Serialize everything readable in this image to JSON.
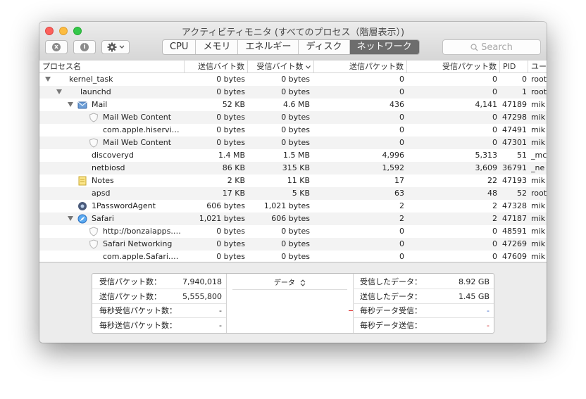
{
  "window": {
    "title": "アクティビティモニタ (すべてのプロセス（階層表示）)"
  },
  "toolbar": {
    "stop_icon": "x",
    "info_icon": "i",
    "tabs": [
      {
        "label": "CPU",
        "active": false
      },
      {
        "label": "メモリ",
        "active": false
      },
      {
        "label": "エネルギー",
        "active": false
      },
      {
        "label": "ディスク",
        "active": false
      },
      {
        "label": "ネットワーク",
        "active": true
      }
    ],
    "search_placeholder": "Search"
  },
  "columns": {
    "name": "プロセス名",
    "sent_bytes": "送信バイト数",
    "recv_bytes": "受信バイト数",
    "sent_packets": "送信パケット数",
    "recv_packets": "受信パケット数",
    "pid": "PID",
    "user": "ユー"
  },
  "rows": [
    {
      "indent": 0,
      "disclosure": true,
      "icon": "",
      "name": "kernel_task",
      "sent": "0 bytes",
      "recv": "0 bytes",
      "spk": "0",
      "rpk": "0",
      "pid": "0",
      "user": "root"
    },
    {
      "indent": 1,
      "disclosure": true,
      "icon": "",
      "name": "launchd",
      "sent": "0 bytes",
      "recv": "0 bytes",
      "spk": "0",
      "rpk": "0",
      "pid": "1",
      "user": "root"
    },
    {
      "indent": 2,
      "disclosure": true,
      "icon": "mail-icon",
      "name": "Mail",
      "sent": "52 KB",
      "recv": "4.6 MB",
      "spk": "436",
      "rpk": "4,141",
      "pid": "47189",
      "user": "mik"
    },
    {
      "indent": 3,
      "disclosure": false,
      "icon": "shield-icon",
      "name": "Mail Web Content",
      "sent": "0 bytes",
      "recv": "0 bytes",
      "spk": "0",
      "rpk": "0",
      "pid": "47298",
      "user": "mik"
    },
    {
      "indent": 3,
      "disclosure": false,
      "icon": "",
      "name": "com.apple.hiservi…",
      "sent": "0 bytes",
      "recv": "0 bytes",
      "spk": "0",
      "rpk": "0",
      "pid": "47491",
      "user": "mik"
    },
    {
      "indent": 3,
      "disclosure": false,
      "icon": "shield-icon",
      "name": "Mail Web Content",
      "sent": "0 bytes",
      "recv": "0 bytes",
      "spk": "0",
      "rpk": "0",
      "pid": "47301",
      "user": "mik"
    },
    {
      "indent": 2,
      "disclosure": false,
      "icon": "",
      "name": "discoveryd",
      "sent": "1.4 MB",
      "recv": "1.5 MB",
      "spk": "4,996",
      "rpk": "5,313",
      "pid": "51",
      "user": "_mc"
    },
    {
      "indent": 2,
      "disclosure": false,
      "icon": "",
      "name": "netbiosd",
      "sent": "86 KB",
      "recv": "315 KB",
      "spk": "1,592",
      "rpk": "3,609",
      "pid": "36791",
      "user": "_ne"
    },
    {
      "indent": 2,
      "disclosure": false,
      "icon": "notes-icon",
      "name": "Notes",
      "sent": "2 KB",
      "recv": "11 KB",
      "spk": "17",
      "rpk": "22",
      "pid": "47193",
      "user": "mik"
    },
    {
      "indent": 2,
      "disclosure": false,
      "icon": "",
      "name": "apsd",
      "sent": "17 KB",
      "recv": "5 KB",
      "spk": "63",
      "rpk": "48",
      "pid": "52",
      "user": "root"
    },
    {
      "indent": 2,
      "disclosure": false,
      "icon": "agent-icon",
      "name": "1PasswordAgent",
      "sent": "606 bytes",
      "recv": "1,021 bytes",
      "spk": "2",
      "rpk": "2",
      "pid": "47328",
      "user": "mik"
    },
    {
      "indent": 2,
      "disclosure": true,
      "icon": "safari-icon",
      "name": "Safari",
      "sent": "1,021 bytes",
      "recv": "606 bytes",
      "spk": "2",
      "rpk": "2",
      "pid": "47187",
      "user": "mik"
    },
    {
      "indent": 3,
      "disclosure": false,
      "icon": "shield-icon",
      "name": "http://bonzaiapps.…",
      "sent": "0 bytes",
      "recv": "0 bytes",
      "spk": "0",
      "rpk": "0",
      "pid": "48591",
      "user": "mik"
    },
    {
      "indent": 3,
      "disclosure": false,
      "icon": "shield-icon",
      "name": "Safari Networking",
      "sent": "0 bytes",
      "recv": "0 bytes",
      "spk": "0",
      "rpk": "0",
      "pid": "47269",
      "user": "mik"
    },
    {
      "indent": 3,
      "disclosure": false,
      "icon": "",
      "name": "com.apple.Safari.…",
      "sent": "0 bytes",
      "recv": "0 bytes",
      "spk": "0",
      "rpk": "0",
      "pid": "47609",
      "user": "mik"
    }
  ],
  "stats": {
    "left": [
      {
        "label": "受信パケット数：",
        "value": "7,940,018"
      },
      {
        "label": "送信パケット数：",
        "value": "5,555,800"
      },
      {
        "label": "毎秒受信パケット数：",
        "value": "-"
      },
      {
        "label": "毎秒送信パケット数：",
        "value": "-"
      }
    ],
    "graph_selector": "データ",
    "right": [
      {
        "label": "受信したデータ：",
        "value": "8.92 GB"
      },
      {
        "label": "送信したデータ：",
        "value": "1.45 GB"
      },
      {
        "label": "毎秒データ受信：",
        "value": "-",
        "color": "#3a63c8"
      },
      {
        "label": "毎秒データ送信：",
        "value": "-",
        "color": "#d33333"
      }
    ]
  },
  "colors": {
    "received": "#3a63c8",
    "sent": "#d33333"
  }
}
